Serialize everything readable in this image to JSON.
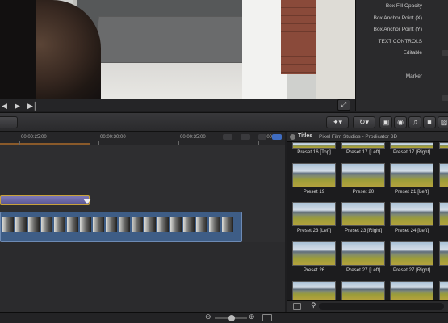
{
  "inspector": {
    "rows": [
      "Box Fill Opacity",
      "Box Anchor Point (X)",
      "Box Anchor Point (Y)",
      "TEXT CONTROLS",
      "Editable",
      "Marker"
    ]
  },
  "timeline": {
    "timecodes": [
      "00:00:25:00",
      "00:00:30:00",
      "00:00:35:00",
      "00:00:40:"
    ]
  },
  "browser": {
    "title": "Titles",
    "subtitle": "Pixel Film Studios - Prodicator 3D",
    "presets": [
      "Preset 16 [Top]",
      "Preset 17 [Left]",
      "Preset 17 [Right]",
      "Preset 19",
      "Preset 20",
      "Preset 21 [Left]",
      "Preset 23 [Left]",
      "Preset 23 [Right]",
      "Preset 24 [Left]",
      "Preset 26",
      "Preset 27 [Left]",
      "Preset 27 [Right]"
    ]
  },
  "icons": {
    "play": "play-icon",
    "prev": "previous-frame-icon",
    "next": "next-frame-icon",
    "fullscreen": "fullscreen-icon",
    "magic": "magic-wand-icon",
    "retime": "retime-icon",
    "photo": "photo-icon",
    "music": "music-icon",
    "film": "filmstrip-icon",
    "search": "search-icon"
  },
  "colors": {
    "accent": "#3f6cc0",
    "title_clip": "#6a67a8",
    "video_clip": "#3e5d86"
  }
}
